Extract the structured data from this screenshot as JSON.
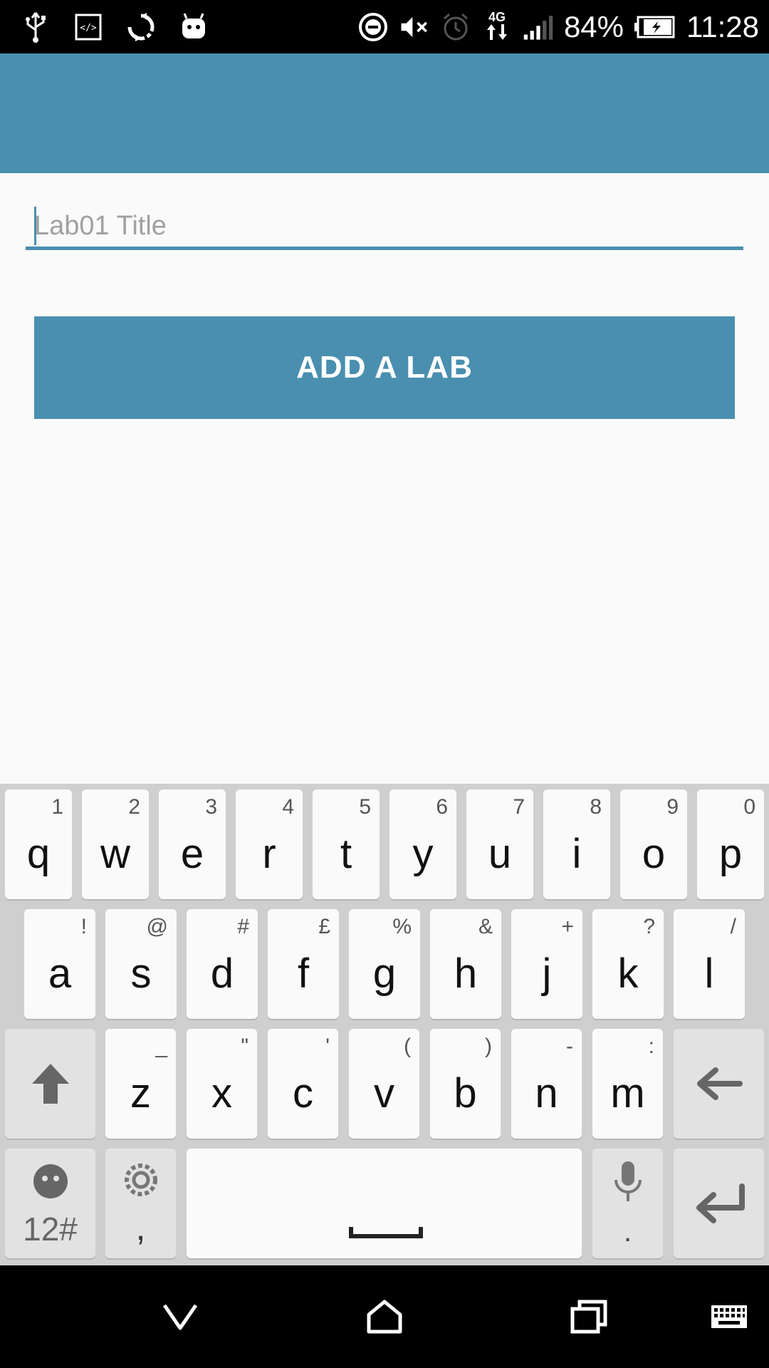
{
  "status_bar": {
    "battery": "84%",
    "time": "11:28",
    "network": "4G"
  },
  "form": {
    "title_placeholder": "Lab01 Title",
    "title_value": "",
    "add_button_label": "ADD A LAB"
  },
  "keyboard": {
    "row1": [
      {
        "key": "q",
        "alt": "1"
      },
      {
        "key": "w",
        "alt": "2"
      },
      {
        "key": "e",
        "alt": "3"
      },
      {
        "key": "r",
        "alt": "4"
      },
      {
        "key": "t",
        "alt": "5"
      },
      {
        "key": "y",
        "alt": "6"
      },
      {
        "key": "u",
        "alt": "7"
      },
      {
        "key": "i",
        "alt": "8"
      },
      {
        "key": "o",
        "alt": "9"
      },
      {
        "key": "p",
        "alt": "0"
      }
    ],
    "row2": [
      {
        "key": "a",
        "alt": "!"
      },
      {
        "key": "s",
        "alt": "@"
      },
      {
        "key": "d",
        "alt": "#"
      },
      {
        "key": "f",
        "alt": "£"
      },
      {
        "key": "g",
        "alt": "%"
      },
      {
        "key": "h",
        "alt": "&"
      },
      {
        "key": "j",
        "alt": "+"
      },
      {
        "key": "k",
        "alt": "?"
      },
      {
        "key": "l",
        "alt": "/"
      }
    ],
    "row3": [
      {
        "key": "z",
        "alt": "_"
      },
      {
        "key": "x",
        "alt": "\""
      },
      {
        "key": "c",
        "alt": "'"
      },
      {
        "key": "v",
        "alt": "("
      },
      {
        "key": "b",
        "alt": ")"
      },
      {
        "key": "n",
        "alt": "-"
      },
      {
        "key": "m",
        "alt": ":"
      }
    ],
    "symbols_label": "12#",
    "comma_label": ",",
    "period_label": "."
  },
  "colors": {
    "accent": "#4a8faf",
    "background": "#fafafa",
    "keyboard_bg": "#cfcfcf"
  }
}
